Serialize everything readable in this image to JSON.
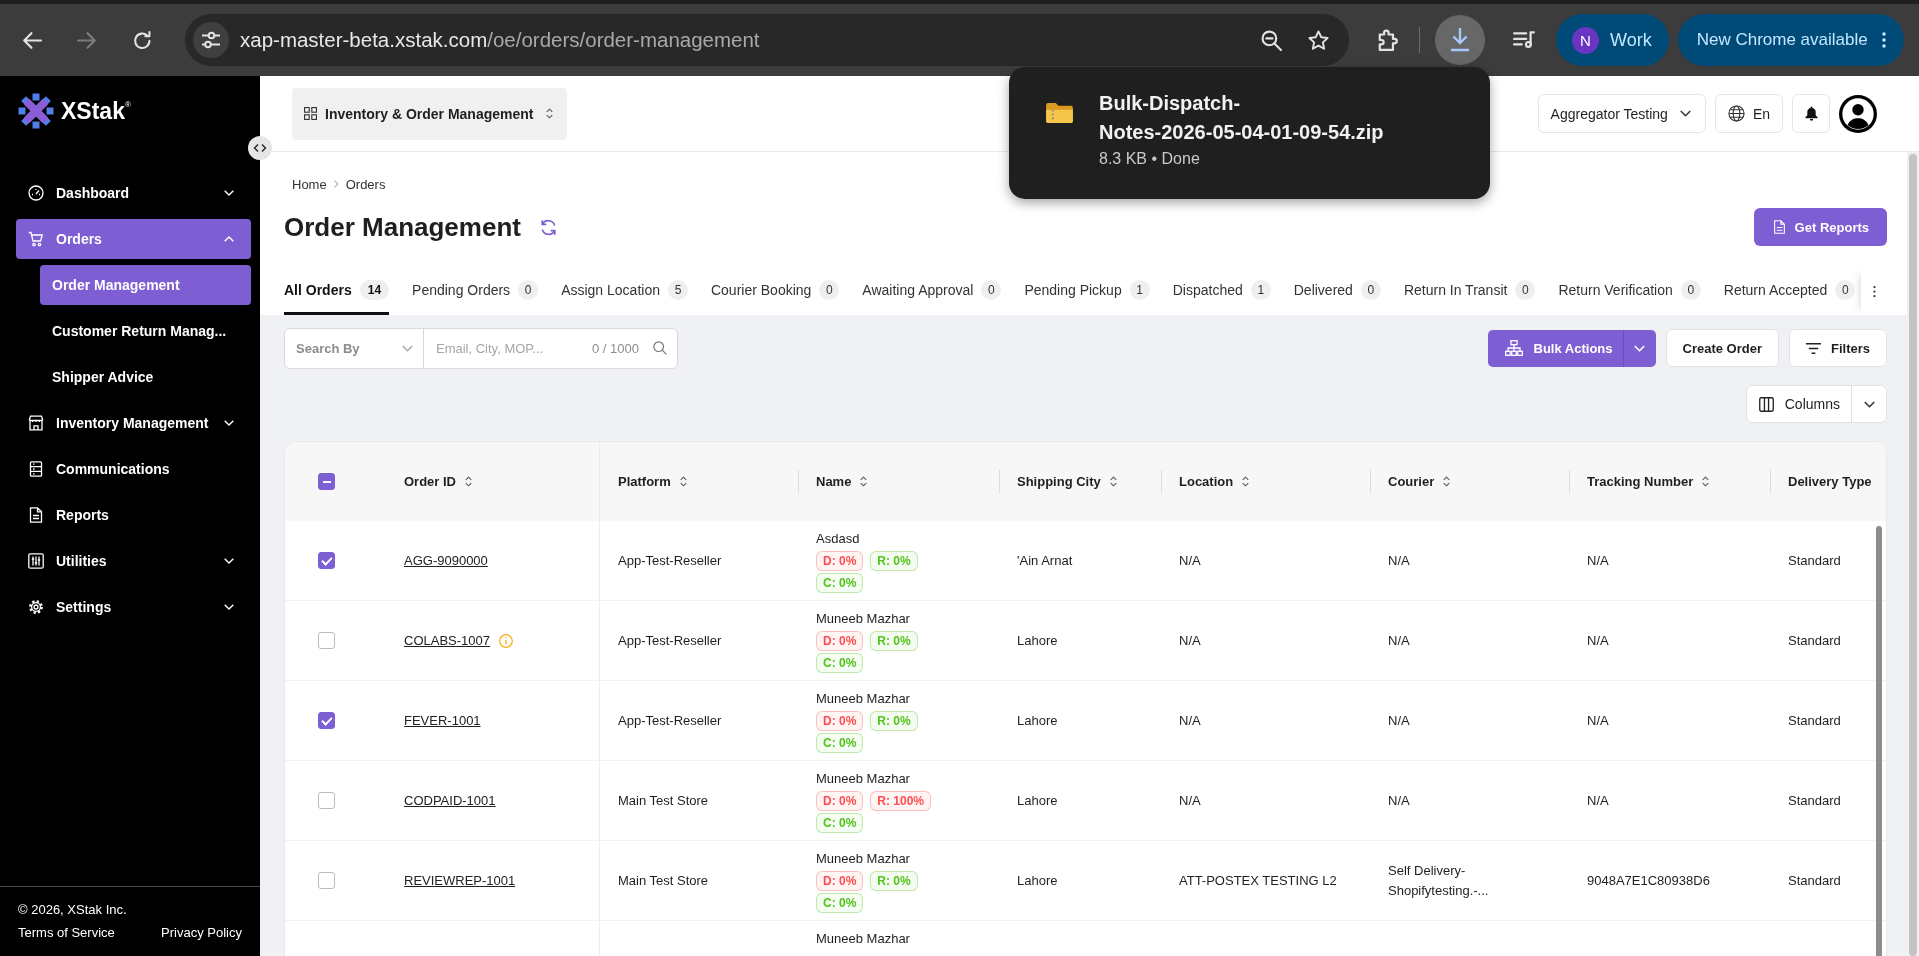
{
  "browser": {
    "back": {
      "disabled": false
    },
    "forward": {
      "disabled": true
    },
    "url_host": "xap-master-beta.xstak.com",
    "url_path": "/oe/orders/order-management",
    "profile": {
      "initial": "N",
      "label": "Work"
    },
    "update_label": "New Chrome available"
  },
  "download_popup": {
    "file_name_lines": [
      "Bulk-Dispatch-",
      "Notes-2026-05-04-01-09-54.zip"
    ],
    "status": "8.3 KB • Done"
  },
  "sidebar": {
    "brand": "XStak$^{®}$",
    "items": [
      {
        "kind": "group",
        "label": "Dashboard",
        "selected": false,
        "expanded": false
      },
      {
        "kind": "group",
        "label": "Orders",
        "selected": true,
        "expanded": true,
        "children": [
          {
            "label": "Order Management",
            "selected": true
          },
          {
            "label": "Customer Return Manag...",
            "selected": false
          },
          {
            "label": "Shipper Advice",
            "selected": false
          }
        ]
      },
      {
        "kind": "group",
        "label": "Inventory Management",
        "selected": false,
        "expanded": false
      },
      {
        "kind": "link",
        "label": "Communications",
        "selected": false
      },
      {
        "kind": "link",
        "label": "Reports",
        "selected": false
      },
      {
        "kind": "group",
        "label": "Utilities",
        "selected": false,
        "expanded": false
      },
      {
        "kind": "group",
        "label": "Settings",
        "selected": false,
        "expanded": false
      }
    ],
    "copyright": "© 2026, XStak Inc.",
    "footer_links": [
      "Terms of Service",
      "Privacy Policy"
    ]
  },
  "header": {
    "app_switcher": "Inventory & Order Management",
    "store_selector": "Aggregator Testing",
    "language": "En"
  },
  "breadcrumb": [
    "Home",
    "Orders"
  ],
  "page_title": "Order Management",
  "get_reports": "Get Reports",
  "tabs": [
    {
      "label": "All Orders",
      "count": "14",
      "selected": true
    },
    {
      "label": "Pending Orders",
      "count": "0",
      "selected": false
    },
    {
      "label": "Assign Location",
      "count": "5",
      "selected": false
    },
    {
      "label": "Courier Booking",
      "count": "0",
      "selected": false
    },
    {
      "label": "Awaiting Approval",
      "count": "0",
      "selected": false
    },
    {
      "label": "Pending Pickup",
      "count": "1",
      "selected": false
    },
    {
      "label": "Dispatched",
      "count": "1",
      "selected": false
    },
    {
      "label": "Delivered",
      "count": "0",
      "selected": false
    },
    {
      "label": "Return In Transit",
      "count": "0",
      "selected": false
    },
    {
      "label": "Return Verification",
      "count": "0",
      "selected": false
    },
    {
      "label": "Return Accepted",
      "count": "0",
      "selected": false
    }
  ],
  "toolbar": {
    "search_by": {
      "placeholder": "Search By"
    },
    "search": {
      "placeholder": "Email, City, MOP...",
      "counter": "0 / 1000"
    },
    "bulk_actions": "Bulk Actions",
    "create_order": "Create Order",
    "filters": "Filters",
    "columns": "Columns"
  },
  "table": {
    "select_all": {
      "indeterminate": true
    },
    "columns": [
      {
        "label": "Order ID",
        "sortable": true
      },
      {
        "label": "Platform",
        "sortable": true
      },
      {
        "label": "Name",
        "sortable": true
      },
      {
        "label": "Shipping City",
        "sortable": true
      },
      {
        "label": "Location",
        "sortable": true
      },
      {
        "label": "Courier",
        "sortable": true
      },
      {
        "label": "Tracking Number",
        "sortable": true
      },
      {
        "label": "Delivery Type",
        "sortable": false
      }
    ],
    "rows": [
      {
        "selected": true,
        "flagged": false,
        "order_id": "AGG-9090000",
        "platform": "App-Test-Reseller",
        "name": "Asdasd",
        "tags": [
          {
            "label": "D: 0%",
            "color": "#ff4d4f"
          },
          {
            "label": "R: 0%",
            "color": "#52c41a"
          },
          {
            "label": "C: 0%",
            "color": "#52c41a"
          }
        ],
        "shipping_city": "'Ain Arnat",
        "location": "N/A",
        "courier": "N/A",
        "tracking_number": "N/A",
        "delivery_type": "Standard"
      },
      {
        "selected": false,
        "flagged": true,
        "order_id": "COLABS-1007",
        "platform": "App-Test-Reseller",
        "name": "Muneeb Mazhar",
        "tags": [
          {
            "label": "D: 0%",
            "color": "#ff4d4f"
          },
          {
            "label": "R: 0%",
            "color": "#52c41a"
          },
          {
            "label": "C: 0%",
            "color": "#52c41a"
          }
        ],
        "shipping_city": "Lahore",
        "location": "N/A",
        "courier": "N/A",
        "tracking_number": "N/A",
        "delivery_type": "Standard"
      },
      {
        "selected": true,
        "flagged": false,
        "order_id": "FEVER-1001",
        "platform": "App-Test-Reseller",
        "name": "Muneeb Mazhar",
        "tags": [
          {
            "label": "D: 0%",
            "color": "#ff4d4f"
          },
          {
            "label": "R: 0%",
            "color": "#52c41a"
          },
          {
            "label": "C: 0%",
            "color": "#52c41a"
          }
        ],
        "shipping_city": "Lahore",
        "location": "N/A",
        "courier": "N/A",
        "tracking_number": "N/A",
        "delivery_type": "Standard"
      },
      {
        "selected": false,
        "flagged": false,
        "order_id": "CODPAID-1001",
        "platform": "Main Test Store",
        "name": "Muneeb Mazhar",
        "tags": [
          {
            "label": "D: 0%",
            "color": "#ff4d4f"
          },
          {
            "label": "R: 100%",
            "color": "#ff4d4f"
          },
          {
            "label": "C: 0%",
            "color": "#52c41a"
          }
        ],
        "shipping_city": "Lahore",
        "location": "N/A",
        "courier": "N/A",
        "tracking_number": "N/A",
        "delivery_type": "Standard"
      },
      {
        "selected": false,
        "flagged": false,
        "order_id": "REVIEWREP-1001",
        "platform": "Main Test Store",
        "name": "Muneeb Mazhar",
        "tags": [
          {
            "label": "D: 0%",
            "color": "#ff4d4f"
          },
          {
            "label": "R: 0%",
            "color": "#52c41a"
          },
          {
            "label": "C: 0%",
            "color": "#52c41a"
          }
        ],
        "shipping_city": "Lahore",
        "location": "ATT-POSTEX TESTING L2",
        "courier": "Self Delivery-Shopifytesting.-...",
        "tracking_number": "9048A7E1C80938D6",
        "delivery_type": "Standard"
      },
      {
        "name": "Muneeb Mazhar"
      }
    ]
  }
}
